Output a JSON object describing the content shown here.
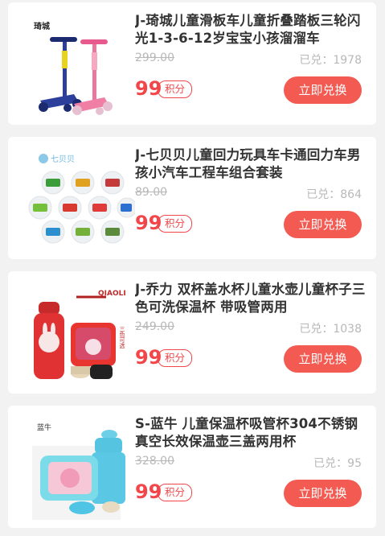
{
  "items": [
    {
      "title": "J-琦城儿童滑板车儿童折叠踏板三轮闪光1-3-6-12岁宝宝小孩溜溜车",
      "original_price": "299.00",
      "sold": "已兑：1978",
      "price": "99",
      "points_badge": "积分",
      "button": "立即兑换",
      "brand_mark": "琦城"
    },
    {
      "title": "J-七贝贝儿童回力玩具车卡通回力车男孩小汽车工程车组合套装",
      "original_price": "89.00",
      "sold": "已兑：864",
      "price": "99",
      "points_badge": "积分",
      "button": "立即兑换",
      "brand_mark": "七贝贝"
    },
    {
      "title": "J-乔力 双杯盖水杯儿童水壶儿童杯子三色可洗保温杯 带吸管两用",
      "original_price": "249.00",
      "sold": "已兑：1038",
      "price": "99",
      "points_badge": "积分",
      "button": "立即兑换",
      "brand_mark": "QIAOLI",
      "side_text": "三色可选"
    },
    {
      "title": "S-蓝牛 儿童保温杯吸管杯304不锈钢真空长效保温壶三盖两用杯",
      "original_price": "328.00",
      "sold": "已兑：95",
      "price": "99",
      "points_badge": "积分",
      "button": "立即兑换",
      "brand_mark": "蓝牛"
    }
  ],
  "colors": {
    "accent": "#f2474a",
    "button": "#f25a52",
    "muted": "#b8b8b8"
  }
}
